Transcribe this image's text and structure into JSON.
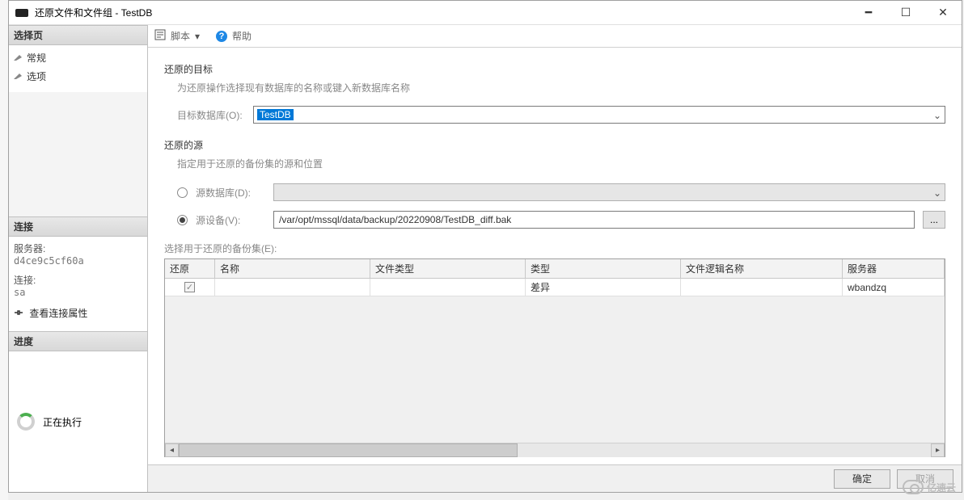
{
  "window": {
    "title": "还原文件和文件组 - TestDB",
    "minimize_tooltip": "Minimize",
    "maximize_tooltip": "Maximize",
    "close_tooltip": "Close"
  },
  "sidebar": {
    "select_page_header": "选择页",
    "pages": [
      {
        "label": "常规"
      },
      {
        "label": "选项"
      }
    ],
    "connection_header": "连接",
    "server_label": "服务器:",
    "server_value": "d4ce9c5cf60a",
    "login_label": "连接:",
    "login_value": "sa",
    "view_connection": "查看连接属性",
    "progress_header": "进度",
    "progress_status": "正在执行"
  },
  "toolbar": {
    "script_label": "脚本",
    "help_label": "帮助"
  },
  "form": {
    "target_group": "还原的目标",
    "target_desc": "为还原操作选择现有数据库的名称或键入新数据库名称",
    "target_db_label": "目标数据库(O):",
    "target_db_value": "TestDB",
    "source_group": "还原的源",
    "source_desc": "指定用于还原的备份集的源和位置",
    "radio_db_label": "源数据库(D):",
    "radio_db_value": "",
    "radio_device_label": "源设备(V):",
    "device_path": "/var/opt/mssql/data/backup/20220908/TestDB_diff.bak",
    "browse_tooltip": "...",
    "backup_sets_label": "选择用于还原的备份集(E):"
  },
  "grid": {
    "columns": [
      "还原",
      "名称",
      "文件类型",
      "类型",
      "文件逻辑名称",
      "服务器"
    ],
    "rows": [
      {
        "restore_checked": true,
        "name": "",
        "file_type": "",
        "type": "差异",
        "logical_name": "",
        "server": "wbandzq"
      }
    ]
  },
  "footer": {
    "ok": "确定",
    "cancel": "取消"
  },
  "watermark": "亿速云"
}
